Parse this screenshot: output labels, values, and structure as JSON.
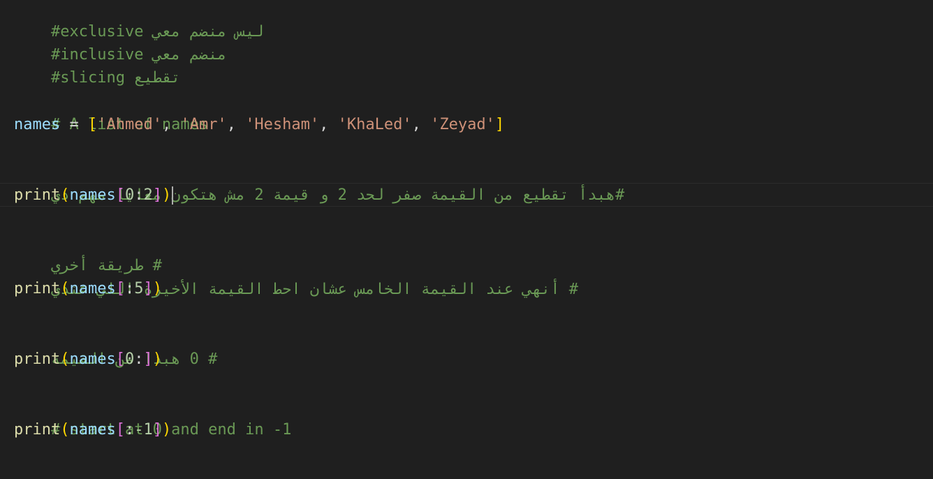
{
  "editor": {
    "lines": {
      "l1": "#exclusive ليس منضم معي",
      "l2": "#inclusive منضم معي",
      "l3": "#slicing تقطيع",
      "l5": "# A list of names",
      "l6": {
        "var": "names",
        "eq": " = ",
        "open": "[",
        "s1": "'Ahmed'",
        "s2": "'Amr'",
        "s3": "'Hesham'",
        "s4": "'KhaLed'",
        "s5": "'Zeyad'",
        "sep": ", ",
        "close": "]"
      },
      "l8": "#هبدأ تقطيع من القيمة صفر لحد 2 و قيمة 2 مش هتكون معايا مهم دي",
      "l9": {
        "fn": "print",
        "open": "(",
        "var": "names",
        "bopen": "[",
        "a": "0",
        "colon": ":",
        "b": "2",
        "bclose": "]",
        "close": ")"
      },
      "l11": "# طريقة أخري",
      "l12": "# أنهي عند القيمة الخامس عشان احط القيمة الأخيرة اللي عندي",
      "l13": {
        "fn": "print",
        "open": "(",
        "var": "names",
        "bopen": "[",
        "colon": ":",
        "b": "5",
        "bclose": "]",
        "close": ")"
      },
      "l15": "# 0 هبدا من القيمة",
      "l16": {
        "fn": "print",
        "open": "(",
        "var": "names",
        "bopen": "[",
        "a": "0",
        "colon": ":",
        "bclose": "]",
        "close": ")"
      },
      "l18": "# start at 0 and end in -1",
      "l19": {
        "fn": "print",
        "open": "(",
        "var": "names",
        "bopen": "[",
        "colon": ":",
        "b": "-1",
        "bclose": "]",
        "close": ")"
      }
    }
  },
  "colors": {
    "background": "#1f1f1f",
    "comment": "#6a9955",
    "variable": "#9cdcfe",
    "function": "#dcdcaa",
    "string": "#ce9178",
    "number": "#b5cea8",
    "bracket_level1": "#ffd700",
    "bracket_level2": "#da70d6"
  }
}
